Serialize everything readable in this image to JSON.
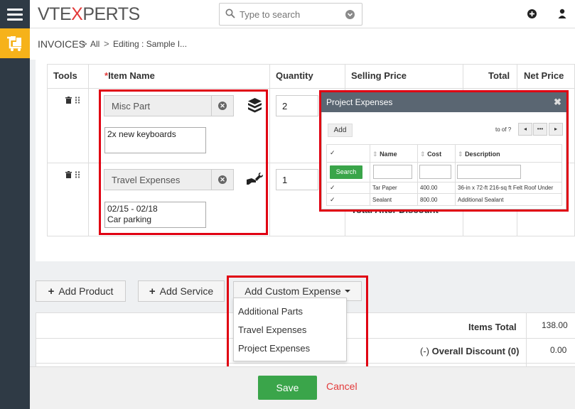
{
  "header": {
    "logo_prefix": "VTE",
    "logo_x": "X",
    "logo_suffix": "PERTS",
    "search_placeholder": "Type to search"
  },
  "breadcrumb": {
    "module": "INVOICES",
    "sep": ">",
    "all": "All",
    "editing": "Editing : Sample I..."
  },
  "items_table": {
    "headers": {
      "tools": "Tools",
      "item_name_req": "*",
      "item_name": "Item Name",
      "quantity": "Quantity",
      "selling_price": "Selling Price",
      "total": "Total",
      "net_price": "Net Price"
    },
    "rows": [
      {
        "item_name": "Misc Part",
        "description_line1": "2x new keyboards",
        "description_line2": "",
        "quantity": "2",
        "type_icon": "box-icon"
      },
      {
        "item_name": "Travel Expenses",
        "description_line1": "02/15 - 02/18",
        "description_line2": "Car parking",
        "quantity": "1",
        "type_icon": "wrench-hand-icon"
      }
    ],
    "hidden_label": "Total After Discount"
  },
  "popup": {
    "title": "Project Expenses",
    "close": "✖",
    "add_label": "Add",
    "pagination_text": "to  of ?",
    "pg_prev": "◂",
    "pg_more": "•••",
    "pg_next": "▸",
    "columns": {
      "name": "Name",
      "cost": "Cost",
      "description": "Description"
    },
    "search_label": "Search",
    "rows": [
      {
        "name": "Tar Paper",
        "cost": "400.00",
        "description": "36-in x 72-ft 216-sq ft Felt Roof Under"
      },
      {
        "name": "Sealant",
        "cost": "800.00",
        "description": "Additional Sealant"
      }
    ]
  },
  "actions": {
    "add_product": "Add Product",
    "add_service": "Add Service",
    "add_custom_expense": "Add Custom Expense",
    "custom_expense_options": [
      "Additional Parts",
      "Travel Expenses",
      "Project Expenses"
    ]
  },
  "totals": {
    "items_total_label": "Items Total",
    "items_total_value": "138.00",
    "overall_discount_prefix": "(-)",
    "overall_discount_label": "Overall Discount (0)",
    "overall_discount_value": "0.00"
  },
  "footer": {
    "save": "Save",
    "cancel": "Cancel"
  },
  "colors": {
    "accent_red": "#e00012",
    "save_green": "#3aa54a",
    "module_yellow": "#f6b21a",
    "sidebar_dark": "#2f3a45"
  }
}
